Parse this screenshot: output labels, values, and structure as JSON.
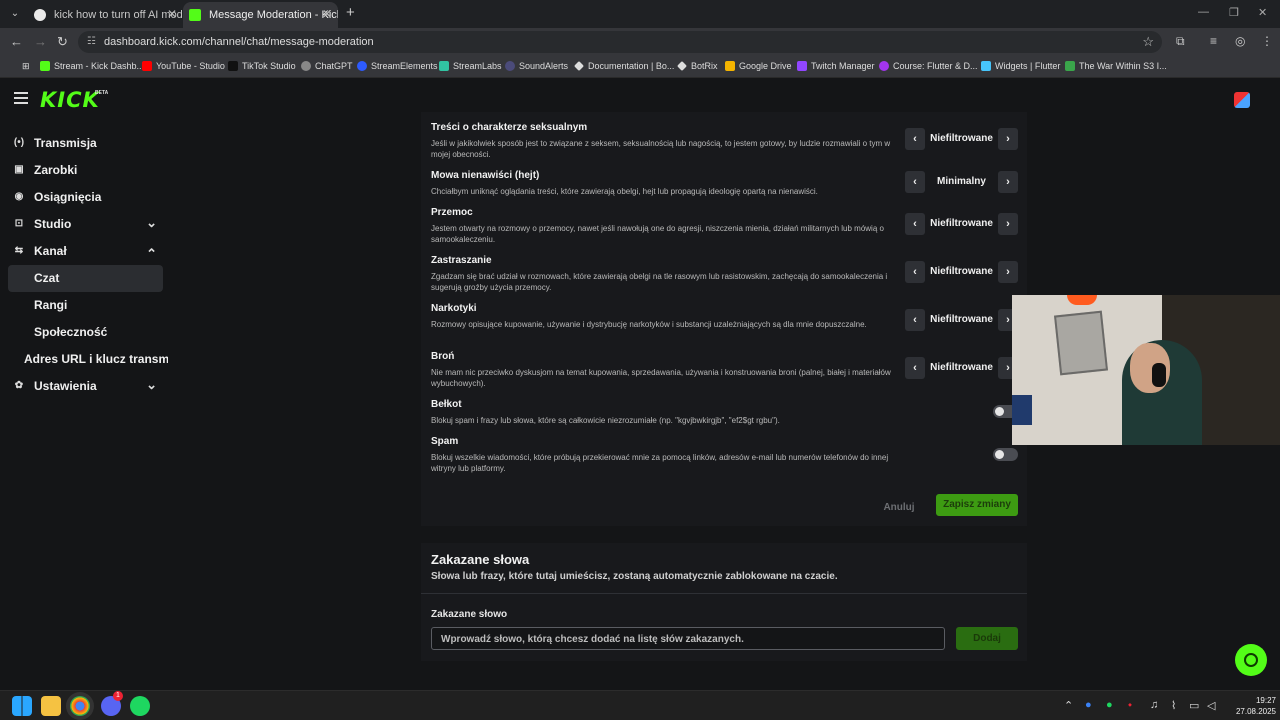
{
  "browser": {
    "tabs": [
      {
        "title": "kick how to turn off AI mod - S",
        "fav_color": "#eaeaea"
      },
      {
        "title": "Message Moderation - Kick Da",
        "fav_color": "#53fc18"
      }
    ],
    "new_tab": "+",
    "url": "dashboard.kick.com/channel/chat/message-moderation",
    "bookmarks": [
      {
        "label": "Stream - Kick Dashb...",
        "color": "#53fc18"
      },
      {
        "label": "YouTube - Studio",
        "color": "#ff0000"
      },
      {
        "label": "TikTok Studio",
        "color": "#111111"
      },
      {
        "label": "ChatGPT",
        "color": "#888888"
      },
      {
        "label": "StreamElements",
        "color": "#2d5bff"
      },
      {
        "label": "StreamLabs",
        "color": "#31c3a2"
      },
      {
        "label": "SoundAlerts",
        "color": "#4b4b7a"
      },
      {
        "label": "Documentation | Bo...",
        "color": "#dddddd"
      },
      {
        "label": "BotRix",
        "color": "#dddddd"
      },
      {
        "label": "Google Drive",
        "color": "#f4b400"
      },
      {
        "label": "Twitch Manager",
        "color": "#9146ff"
      },
      {
        "label": "Course: Flutter & D...",
        "color": "#a335ee"
      },
      {
        "label": "Widgets | Flutter",
        "color": "#47c5fb"
      },
      {
        "label": "The War Within S3 I...",
        "color": "#3aa54b"
      }
    ]
  },
  "app": {
    "logo": "KICK",
    "beta": "BETA"
  },
  "sidebar": {
    "items": [
      {
        "label": "Transmisja",
        "icon": "(•)"
      },
      {
        "label": "Zarobki",
        "icon": "▣"
      },
      {
        "label": "Osiągnięcia",
        "icon": "◉"
      },
      {
        "label": "Studio",
        "icon": "⊡"
      },
      {
        "label": "Kanał",
        "icon": "⇆"
      },
      {
        "label": "Czat"
      },
      {
        "label": "Rangi"
      },
      {
        "label": "Społeczność"
      },
      {
        "label": "Adres URL i klucz transmisj"
      },
      {
        "label": "Ustawienia",
        "icon": "✿"
      }
    ]
  },
  "moderation": {
    "categories": [
      {
        "title": "Treści o charakterze seksualnym",
        "desc": "Jeśli w jakikolwiek sposób jest to związane z seksem, seksualnością lub nagością, to jestem gotowy, by ludzie rozmawiali o tym w mojej obecności.",
        "value": "Niefiltrowane"
      },
      {
        "title": "Mowa nienawiści (hejt)",
        "desc": "Chciałbym uniknąć oglądania treści, które zawierają obelgi, hejt lub propagują ideologię opartą na nienawiści.",
        "value": "Minimalny"
      },
      {
        "title": "Przemoc",
        "desc": "Jestem otwarty na rozmowy o przemocy, nawet jeśli nawołują one do agresji, niszczenia mienia, działań militarnych lub mówią o samookaleczeniu.",
        "value": "Niefiltrowane"
      },
      {
        "title": "Zastraszanie",
        "desc": "Zgadzam się brać udział w rozmowach, które zawierają obelgi na tle rasowym lub rasistowskim, zachęcają do samookaleczenia i sugerują groźby użycia przemocy.",
        "value": "Niefiltrowane"
      },
      {
        "title": "Narkotyki",
        "desc": "Rozmowy opisujące kupowanie, używanie i dystrybucję narkotyków i substancji uzależniających są dla mnie dopuszczalne.",
        "value": "Niefiltrowane"
      },
      {
        "title": "Broń",
        "desc": "Nie mam nic przeciwko dyskusjom na temat kupowania, sprzedawania, używania i konstruowania broni (palnej, białej i materiałów wybuchowych).",
        "value": "Niefiltrowane"
      }
    ],
    "toggles": [
      {
        "title": "Bełkot",
        "desc": "Blokuj spam i frazy lub słowa, które są całkowicie niezrozumiałe (np. \"kgvjbwkirgjb\", \"ef2$gt rgbu\").",
        "enabled": false
      },
      {
        "title": "Spam",
        "desc": "Blokuj wszelkie wiadomości, które próbują przekierować mnie za pomocą linków, adresów e-mail lub numerów telefonów do innej witryny lub platformy.",
        "enabled": false
      }
    ],
    "cancel": "Anuluj",
    "save": "Zapisz zmiany"
  },
  "banned_words": {
    "title": "Zakazane słowa",
    "subtitle": "Słowa lub frazy, które tutaj umieścisz, zostaną automatycznie zablokowane na czacie.",
    "label": "Zakazane słowo",
    "placeholder": "Wprowadź słowo, którą chcesz dodać na listę słów zakazanych.",
    "add": "Dodaj"
  },
  "taskbar": {
    "time": "19:27",
    "date": "27.08.2025",
    "discord_badge": "1"
  }
}
